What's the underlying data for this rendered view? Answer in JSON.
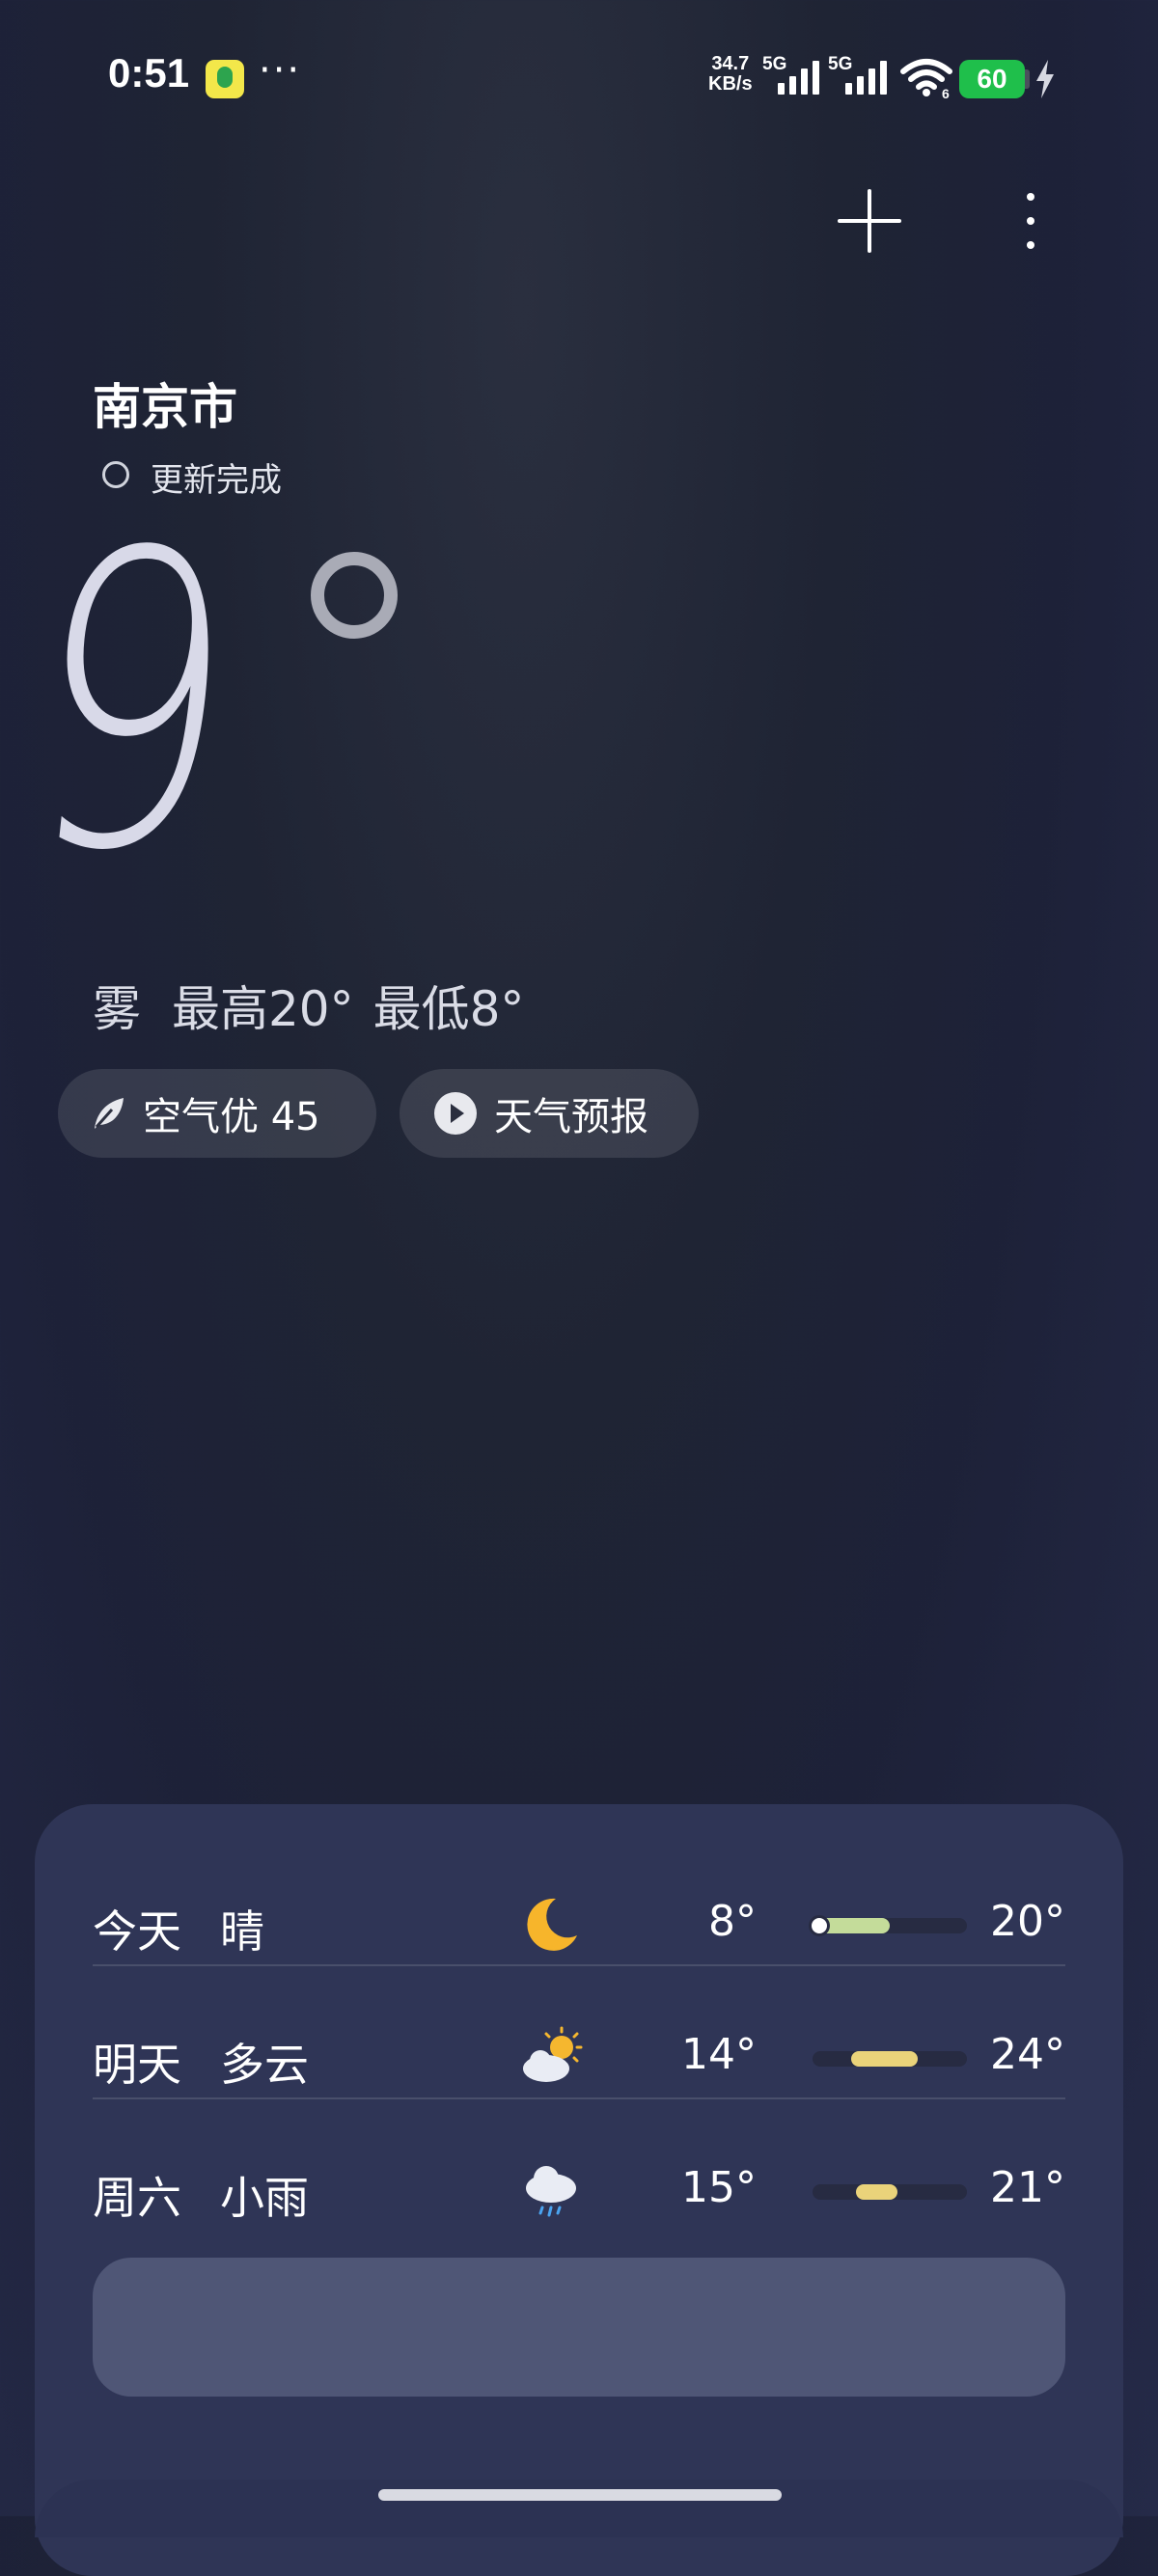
{
  "status_bar": {
    "time": "0:51",
    "dots": "···",
    "net_speed_value": "34.7",
    "net_speed_unit": "KB/s",
    "sim1": "5G",
    "sim2": "5G",
    "wifi_number": "6",
    "battery": "60",
    "battery_color": "#1fbf4b"
  },
  "header": {
    "add_icon": "plus-icon",
    "more_icon": "more-vertical-icon"
  },
  "location": {
    "city": "南京市",
    "update_status": "更新完成"
  },
  "current": {
    "temperature": "9",
    "condition": "雾",
    "high_label": "最高20°",
    "low_label": "最低8°"
  },
  "chips": {
    "air_quality": "空气优 45",
    "forecast_video": "天气预报"
  },
  "forecast": [
    {
      "day": "今天",
      "condition": "晴",
      "icon": "moon-icon",
      "low": "8°",
      "high": "20°",
      "range_start": 0.0,
      "range_end": 0.5,
      "color": "#c4dc9a",
      "current_marker": true
    },
    {
      "day": "明天",
      "condition": "多云",
      "icon": "partly-cloudy-icon",
      "low": "14°",
      "high": "24°",
      "range_start": 0.25,
      "range_end": 0.68,
      "color": "#ead37a",
      "current_marker": false
    },
    {
      "day": "周六",
      "condition": "小雨",
      "icon": "light-rain-icon",
      "low": "15°",
      "high": "21°",
      "range_start": 0.28,
      "range_end": 0.55,
      "color": "#ead37a",
      "current_marker": false
    }
  ]
}
